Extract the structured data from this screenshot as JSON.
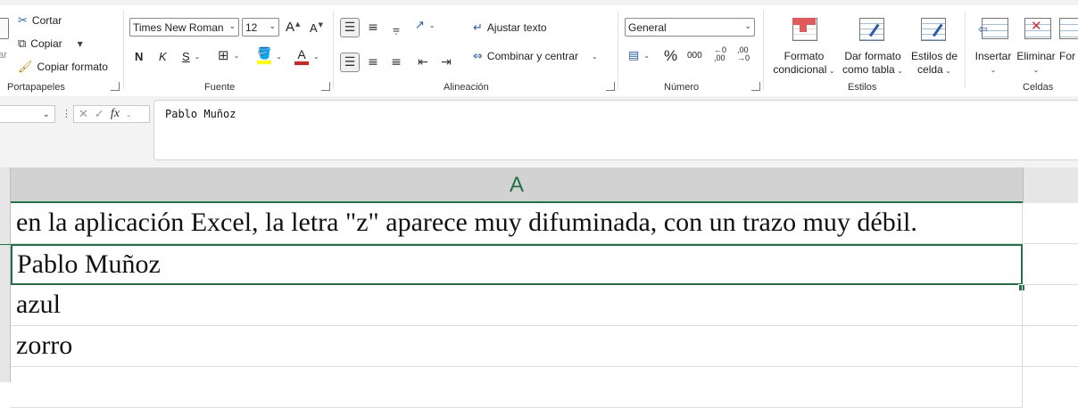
{
  "ribbon": {
    "clipboard": {
      "group_label": "Portapapeles",
      "paste_partial": "ar",
      "cut": "Cortar",
      "copy": "Copiar",
      "format_painter": "Copiar formato"
    },
    "font": {
      "group_label": "Fuente",
      "font_name": "Times New Roman",
      "font_size": "12",
      "bold": "N",
      "italic": "K",
      "underline": "S",
      "grow": "A",
      "shrink": "A",
      "font_color_letter": "A"
    },
    "alignment": {
      "group_label": "Alineación",
      "wrap_text": "Ajustar texto",
      "merge_center": "Combinar y centrar"
    },
    "number": {
      "group_label": "Número",
      "format": "General",
      "percent": "%",
      "thousands": "000",
      "inc_decimals": "←0 ,00",
      "dec_decimals": ",00 →0"
    },
    "styles": {
      "group_label": "Estilos",
      "conditional_format": [
        "Formato",
        "condicional"
      ],
      "format_as_table": [
        "Dar formato",
        "como tabla"
      ],
      "cell_styles": [
        "Estilos de",
        "celda"
      ]
    },
    "cells": {
      "group_label": "Celdas",
      "insert": "Insertar",
      "delete": "Eliminar",
      "format_partial": "For"
    },
    "accent": "#217346",
    "highlight_color": "#ffff00",
    "font_color": "#e0201b"
  },
  "formula_bar": {
    "fx_label": "fx",
    "content": "Pablo Muñoz"
  },
  "sheet": {
    "column_header": "A",
    "cells": [
      "en la aplicación Excel, la letra \"z\" aparece muy difuminada, con un trazo muy débil.",
      "Pablo Muñoz",
      "azul",
      "zorro"
    ]
  }
}
